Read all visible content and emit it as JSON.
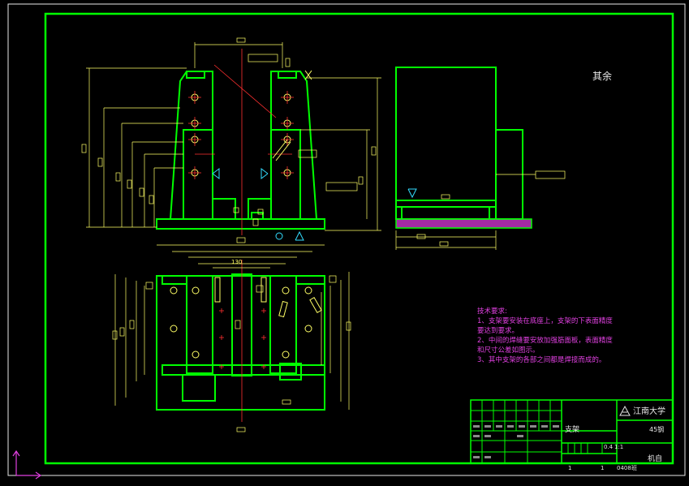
{
  "drawing": {
    "colors": {
      "background": "#000000",
      "frame": "#00ff00",
      "outline": "#00ff00",
      "dimension": "#ffff66",
      "centerline": "#ff3030",
      "hatch": "#cc33cc",
      "notes": "#e040e0",
      "text": "#e8e8e8",
      "cyan_symbols": "#33ddff"
    },
    "roughness_note": "其余",
    "dim_130": "130",
    "technical_requirements": {
      "title": "技术要求:",
      "lines": [
        "1、支架要安装在底座上，支架的下表面精度",
        "要达到要求。",
        "2、中间的焊缝要安放加强筋面板，表面精度",
        "和尺寸公差如图示。",
        "3、其中支架的各部之间都是焊接而成的。"
      ]
    },
    "title_block": {
      "part_name": "支架",
      "material": "45钢",
      "school": "江南大学",
      "school_logo": "triangle-logo-icon",
      "scale": "1:1",
      "weight_label": "0.4",
      "sheet_left": "1",
      "sheet_right": "1",
      "drawing_no": "0408班",
      "department": "机自"
    }
  }
}
